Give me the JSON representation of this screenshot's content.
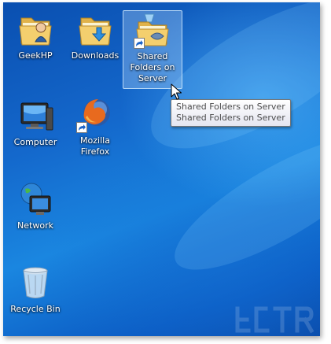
{
  "desktop": {
    "icons": [
      {
        "id": "geekhp",
        "label": "GeekHP",
        "icon": "user-folder-icon"
      },
      {
        "id": "downloads",
        "label": "Downloads",
        "icon": "downloads-folder-icon"
      },
      {
        "id": "shared",
        "label": "Shared Folders on Server",
        "icon": "shared-folder-shortcut-icon",
        "selected": true
      },
      {
        "id": "computer",
        "label": "Computer",
        "icon": "computer-icon"
      },
      {
        "id": "firefox",
        "label": "Mozilla Firefox",
        "icon": "firefox-shortcut-icon"
      },
      {
        "id": "network",
        "label": "Network",
        "icon": "network-icon"
      },
      {
        "id": "recycle",
        "label": "Recycle Bin",
        "icon": "recycle-bin-icon"
      }
    ]
  },
  "tooltip": {
    "line1": "Shared Folders on Server",
    "line2": "Shared Folders on Server"
  },
  "colors": {
    "desktop_blue": "#1468cc",
    "selection": "#b4d7fa",
    "tooltip_border": "#767676"
  }
}
